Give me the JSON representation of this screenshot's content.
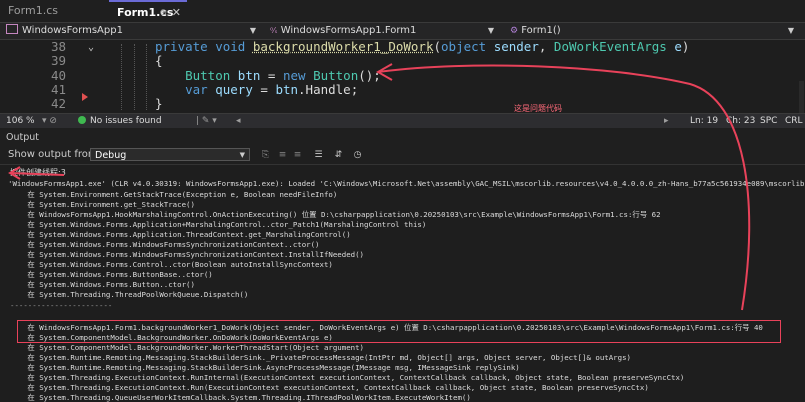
{
  "tabs": {
    "inactive_label": "Form1.cs [Design]",
    "active_label": "Form1.cs",
    "pin_symbol": "⊕",
    "close_symbol": "✕"
  },
  "navbar": {
    "project": "WindowsFormsApp1",
    "class": "WindowsFormsApp1.Form1",
    "class_prefix": "⁴ᵃ",
    "member": "Form1()",
    "member_prefix": "⚙"
  },
  "editor": {
    "lines": [
      {
        "num": "38",
        "tokens": [
          [
            "kw",
            "private "
          ],
          [
            "kw",
            "void "
          ],
          [
            "fn",
            "backgroundWorker1_DoWork"
          ],
          [
            "",
            "("
          ],
          [
            "kw",
            "object "
          ],
          [
            "pa",
            "sender"
          ],
          [
            "",
            ", "
          ],
          [
            "ty",
            "DoWorkEventArgs "
          ],
          [
            "pa",
            "e"
          ],
          [
            "",
            ")"
          ]
        ]
      },
      {
        "num": "39",
        "tokens": [
          [
            "",
            "{"
          ]
        ]
      },
      {
        "num": "40",
        "tokens": [
          [
            "ty",
            "    Button "
          ],
          [
            "pa",
            "btn"
          ],
          [
            "",
            " = "
          ],
          [
            "kw",
            "new "
          ],
          [
            "ty",
            "Button"
          ],
          [
            "",
            "();"
          ]
        ]
      },
      {
        "num": "41",
        "tokens": [
          [
            "kw",
            "    var "
          ],
          [
            "pa",
            "query"
          ],
          [
            "",
            " = "
          ],
          [
            "pa",
            "btn"
          ],
          [
            "",
            ".Handle;"
          ]
        ]
      },
      {
        "num": "42",
        "tokens": [
          [
            "",
            "}"
          ]
        ]
      }
    ],
    "fold_symbol": "⌄"
  },
  "statusbar": {
    "zoom": "106 %",
    "issues": "No issues found",
    "position": "Ln: 19",
    "column": "Ch: 23",
    "encoding": "SPC",
    "line_ending": "CRL"
  },
  "output": {
    "title": "Output",
    "show_from_label": "Show output from:",
    "source": "Debug",
    "lines": [
      "控件创建线程:3",
      "'WindowsFormsApp1.exe' (CLR v4.0.30319: WindowsFormsApp1.exe): Loaded 'C:\\Windows\\Microsoft.Net\\assembly\\GAC_MSIL\\mscorlib.resources\\v4.0_4.0.0.0_zh-Hans_b77a5c561934e089\\mscorlib",
      "   在 System.Environment.GetStackTrace(Exception e, Boolean needFileInfo)",
      "   在 System.Environment.get_StackTrace()",
      "   在 WindowsFormsApp1.HookMarshalingControl.OnActionExecuting() 位置 D:\\csharpapplication\\0.20250103\\src\\Example\\WindowsFormsApp1\\Form1.cs:行号 62",
      "   在 System.Windows.Forms.Application+MarshalingControl..ctor_Patch1(MarshalingControl this)",
      "   在 System.Windows.Forms.Application.ThreadContext.get_MarshalingControl()",
      "   在 System.Windows.Forms.WindowsFormsSynchronizationContext..ctor()",
      "   在 System.Windows.Forms.WindowsFormsSynchronizationContext.InstallIfNeeded()",
      "   在 System.Windows.Forms.Control..ctor(Boolean autoInstallSyncContext)",
      "   在 System.Windows.Forms.ButtonBase..ctor()",
      "   在 System.Windows.Forms.Button..ctor()",
      "   在 WindowsFormsApp1.Form1.backgroundWorker1_DoWork(Object sender, DoWorkEventArgs e) 位置 D:\\csharpapplication\\0.20250103\\src\\Example\\WindowsFormsApp1\\Form1.cs:行号 40",
      "   在 System.ComponentModel.BackgroundWorker.OnDoWork(DoWorkEventArgs e)",
      "   在 System.ComponentModel.BackgroundWorker.WorkerThreadStart(Object argument)",
      "   在 System.Runtime.Remoting.Messaging.StackBuilderSink._PrivateProcessMessage(IntPtr md, Object[] args, Object server, Object[]& outArgs)",
      "   在 System.Runtime.Remoting.Messaging.StackBuilderSink.AsyncProcessMessage(IMessage msg, IMessageSink replySink)",
      "   在 System.Threading.ExecutionContext.RunInternal(ExecutionContext executionContext, ContextCallback callback, Object state, Boolean preserveSyncCtx)",
      "   在 System.Threading.ExecutionContext.Run(ExecutionContext executionContext, ContextCallback callback, Object state, Boolean preserveSyncCtx)",
      "   在 System.Threading.QueueUserWorkItemCallback.System.Threading.IThreadPoolWorkItem.ExecuteWorkItem()",
      "   在 System.Threading.ThreadPoolWorkQueue.Dispatch()",
      "-----------------------"
    ]
  },
  "annotation": {
    "text": "这是问题代码",
    "color": "#e8425a"
  },
  "colors": {
    "accent": "#6b6bd6",
    "keyword": "#569cd6",
    "type": "#4ec9b0",
    "method": "#dcdcaa",
    "param": "#9cdcfe",
    "highlight_red": "#e8425a"
  }
}
